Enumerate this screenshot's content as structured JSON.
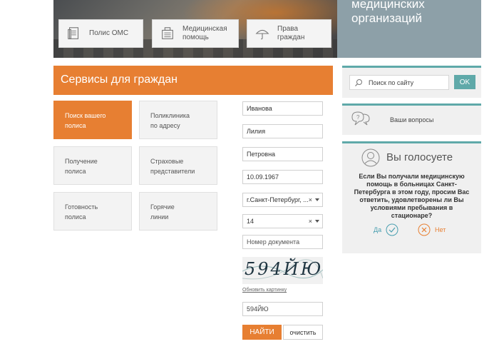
{
  "banner": {
    "tiles": [
      {
        "label": "Полис ОМС",
        "icon": "document-icon"
      },
      {
        "label": "Медицинская помощь",
        "icon": "hospital-icon"
      },
      {
        "label": "Права граждан",
        "icon": "umbrella-icon"
      }
    ],
    "right_title": "медицинских организаций"
  },
  "services": {
    "title": "Сервисы для граждан",
    "tiles": [
      {
        "label": "Поиск вашего полиса",
        "active": true
      },
      {
        "label": "Поликлиника по адресу"
      },
      {
        "label": "Получение полиса"
      },
      {
        "label": "Страховые представители"
      },
      {
        "label": "Готовность полиса"
      },
      {
        "label": "Горячие линии"
      }
    ]
  },
  "form": {
    "last_name": "Иванова",
    "first_name": "Лилия",
    "patronymic": "Петровна",
    "birth_date": "10.09.1967",
    "city": "г.Санкт-Петербург, ...",
    "doc_type": "14",
    "doc_number_placeholder": "Номер документа",
    "captcha_text": "594ЙЮ",
    "captcha_refresh": "Обновить картинку",
    "captcha_input": "594ЙЮ",
    "find_label": "НАЙТИ",
    "clear_label": "очистить"
  },
  "sidebar": {
    "search_placeholder": "Поиск по сайту",
    "search_button": "OK",
    "questions_label": "Ваши вопросы",
    "vote_title": "Вы голосуете",
    "vote_question": "Если Вы получали медицинскую помощь в больницах Санкт-Петербурга в этом году, просим Вас ответить, удовлетворены ли Вы условиями пребывания в стационаре?",
    "yes_label": "Да",
    "no_label": "Нет"
  },
  "colors": {
    "accent": "#e77f32",
    "teal": "#5fa9a9",
    "grey_panel": "#8da0a8"
  }
}
